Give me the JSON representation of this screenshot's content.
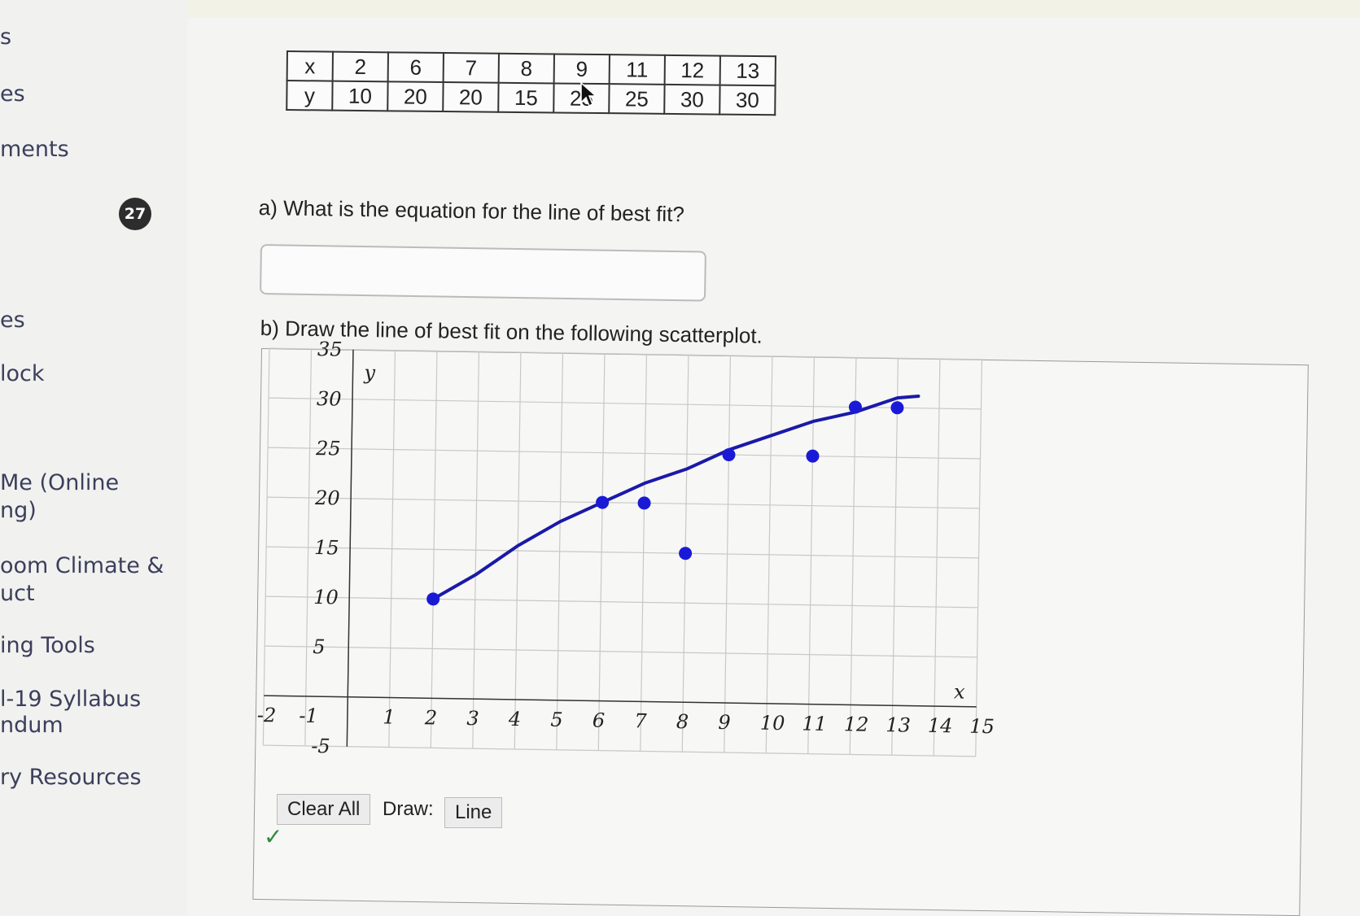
{
  "sidebar": {
    "items": [
      {
        "label": "s"
      },
      {
        "label": "es"
      },
      {
        "label": "ments"
      },
      {
        "label": "es"
      },
      {
        "label": "lock"
      },
      {
        "label": "Me (Online"
      },
      {
        "label": "ng)"
      },
      {
        "label": "oom Climate &"
      },
      {
        "label": "uct"
      },
      {
        "label": "ing Tools"
      },
      {
        "label": "l-19 Syllabus"
      },
      {
        "label": "ndum"
      },
      {
        "label": "ry Resources"
      }
    ]
  },
  "question": {
    "number": "27",
    "table": {
      "x_label": "x",
      "y_label": "y",
      "x": [
        "2",
        "6",
        "7",
        "8",
        "9",
        "11",
        "12",
        "13"
      ],
      "y": [
        "10",
        "20",
        "20",
        "15",
        "25",
        "25",
        "30",
        "30"
      ]
    },
    "part_a": "a) What is the equation for the line of best fit?",
    "answer_value": "",
    "part_b": "b) Draw the line of best fit on the following scatterplot."
  },
  "chart_data": {
    "type": "scatter",
    "xlabel": "x",
    "ylabel": "y",
    "xlim": [
      -2,
      15
    ],
    "ylim": [
      -5,
      35
    ],
    "x_ticks": [
      "-2",
      "-1",
      "1",
      "2",
      "3",
      "4",
      "5",
      "6",
      "7",
      "8",
      "9",
      "10",
      "11",
      "12",
      "13",
      "14",
      "15"
    ],
    "y_ticks": [
      "35",
      "30",
      "25",
      "20",
      "15",
      "10",
      "5",
      "-5"
    ],
    "points": [
      {
        "x": 2,
        "y": 10
      },
      {
        "x": 6,
        "y": 20
      },
      {
        "x": 7,
        "y": 20
      },
      {
        "x": 8,
        "y": 15
      },
      {
        "x": 9,
        "y": 25
      },
      {
        "x": 11,
        "y": 25
      },
      {
        "x": 12,
        "y": 30
      },
      {
        "x": 13,
        "y": 30
      }
    ],
    "drawn_line": [
      {
        "x": 2,
        "y": 10
      },
      {
        "x": 3,
        "y": 12.5
      },
      {
        "x": 4,
        "y": 15.5
      },
      {
        "x": 5,
        "y": 18
      },
      {
        "x": 6,
        "y": 20
      },
      {
        "x": 7,
        "y": 22
      },
      {
        "x": 8,
        "y": 23.5
      },
      {
        "x": 9,
        "y": 25.5
      },
      {
        "x": 10,
        "y": 27
      },
      {
        "x": 11,
        "y": 28.5
      },
      {
        "x": 12,
        "y": 29.5
      },
      {
        "x": 13,
        "y": 31
      },
      {
        "x": 13.5,
        "y": 31.2
      }
    ],
    "point_color": "#1a1ad6",
    "line_color": "#1a1aa8",
    "grid": true
  },
  "controls": {
    "clear_all": "Clear All",
    "draw_label": "Draw:",
    "draw_mode": "Line"
  }
}
